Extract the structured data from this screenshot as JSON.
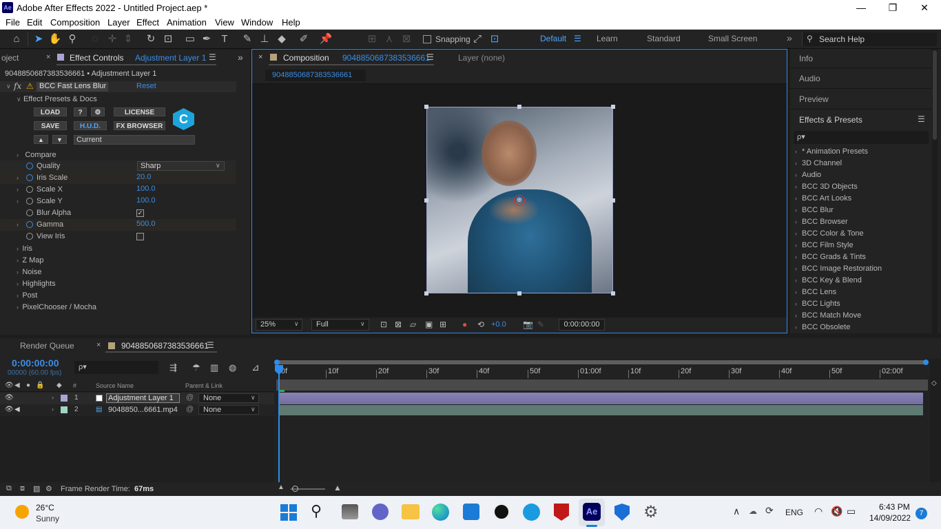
{
  "window": {
    "app_icon": "Ae",
    "title": "Adobe After Effects 2022 - Untitled Project.aep *",
    "minimize": "—",
    "maximize": "❐",
    "close": "✕"
  },
  "menu": [
    "File",
    "Edit",
    "Composition",
    "Layer",
    "Effect",
    "Animation",
    "View",
    "Window",
    "Help"
  ],
  "toolbar": {
    "snapping_label": "Snapping",
    "workspaces": [
      "Default",
      "Learn",
      "Standard",
      "Small Screen"
    ],
    "search_placeholder": "Search Help",
    "more": "»"
  },
  "effect_controls": {
    "left_tab": "oject",
    "tab_label": "Effect Controls",
    "tab_layer": "Adjustment Layer 1",
    "breadcrumb": "9048850687383536661 • Adjustment Layer 1",
    "effect_name": "BCC Fast Lens Blur",
    "reset_label": "Reset",
    "presets_label": "Effect Presets & Docs",
    "buttons": {
      "load": "LOAD",
      "help": "?",
      "license": "LICENSE",
      "save": "SAVE",
      "hud": "H.U.D.",
      "fx_browser": "FX BROWSER",
      "logo": "C"
    },
    "preset_current": "Current",
    "params": [
      {
        "name": "Compare"
      },
      {
        "name": "Quality",
        "value": "Sharp"
      },
      {
        "name": "Iris Scale",
        "value": "20.0"
      },
      {
        "name": "Scale X",
        "value": "100.0"
      },
      {
        "name": "Scale Y",
        "value": "100.0"
      },
      {
        "name": "Blur Alpha",
        "checked": true
      },
      {
        "name": "Gamma",
        "value": "500.0"
      },
      {
        "name": "View Iris",
        "checked": false
      }
    ],
    "groups": [
      "Iris",
      "Z Map",
      "Noise",
      "Highlights",
      "Post",
      "PixelChooser / Mocha"
    ]
  },
  "composition": {
    "tab_label": "Composition",
    "tab_comp": "9048850687383536661",
    "layer_tab": "Layer  (none)",
    "subtab": "9048850687383536661",
    "zoom": "25%",
    "resolution": "Full",
    "exposure": "+0.0",
    "timecode": "0:00:00:00"
  },
  "right_panels": {
    "info": "Info",
    "audio": "Audio",
    "preview": "Preview",
    "effects_presets": "Effects & Presets",
    "search_placeholder": "ρ▾",
    "categories": [
      "* Animation Presets",
      "3D Channel",
      "Audio",
      "BCC 3D Objects",
      "BCC Art Looks",
      "BCC Blur",
      "BCC Browser",
      "BCC Color & Tone",
      "BCC Film Style",
      "BCC Grads & Tints",
      "BCC Image Restoration",
      "BCC Key & Blend",
      "BCC Lens",
      "BCC Lights",
      "BCC Match Move",
      "BCC Obsolete"
    ]
  },
  "timeline": {
    "render_queue": "Render Queue",
    "comp_tab": "9048850687383536661",
    "timecode": "0:00:00:00",
    "fps": "00000 (60.00 fps)",
    "search_placeholder": "ρ▾",
    "col_hash": "#",
    "col_source": "Source Name",
    "col_parent": "Parent & Link",
    "layers": [
      {
        "num": "1",
        "name": "Adjustment Layer 1",
        "parent": "None",
        "color": "#a9a4d6"
      },
      {
        "num": "2",
        "name": "9048850...6661.mp4",
        "parent": "None",
        "color": "#9fd5c5"
      }
    ],
    "ruler": [
      "0f",
      "10f",
      "20f",
      "30f",
      "40f",
      "50f",
      "01:00f",
      "10f",
      "20f",
      "30f",
      "40f",
      "50f",
      "02:00f"
    ],
    "frame_render_label": "Frame Render Time:",
    "frame_render_value": "67ms"
  },
  "taskbar": {
    "weather_temp": "26°C",
    "weather_desc": "Sunny",
    "lang": "ENG",
    "time": "6:43 PM",
    "date": "14/09/2022",
    "notif_count": "7",
    "ae_label": "Ae"
  }
}
